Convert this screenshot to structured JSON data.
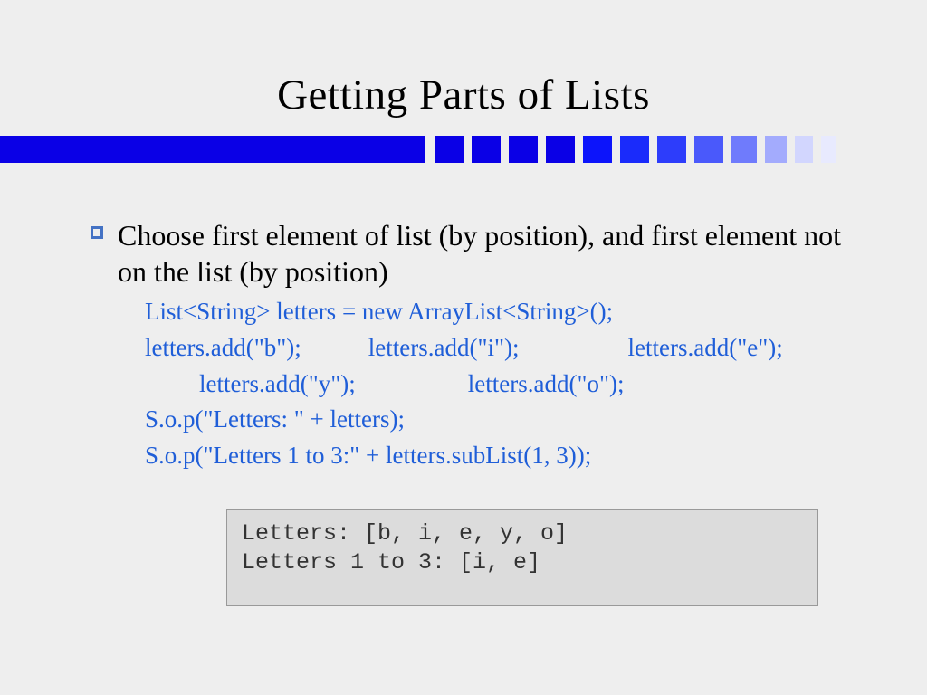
{
  "title": "Getting Parts of Lists",
  "bullet": "Choose first element of list (by position), and first element not on the list (by position)",
  "code": {
    "l1": "List<String> letters = new ArrayList<String>();",
    "l2a": "letters.add(\"b\");",
    "l2b": "letters.add(\"i\");",
    "l2c": "letters.add(\"e\");",
    "l3a": "letters.add(\"y\");",
    "l3b": "letters.add(\"o\");",
    "l4": "S.o.p(\"Letters: \" + letters);",
    "l5": "S.o.p(\"Letters 1 to 3:\" + letters.subList(1, 3));"
  },
  "output": "Letters: [b, i, e, y, o]\nLetters 1 to 3: [i, e]",
  "dividerColors": [
    "#0a00e6",
    "#0a00e6",
    "#0a00e6",
    "#0a00e6",
    "#0c14fb",
    "#1a2bfb",
    "#2d3dfb",
    "#4a59fb",
    "#6f7bfc",
    "#a3abfd",
    "#d2d6fe",
    "#e8eafe"
  ]
}
